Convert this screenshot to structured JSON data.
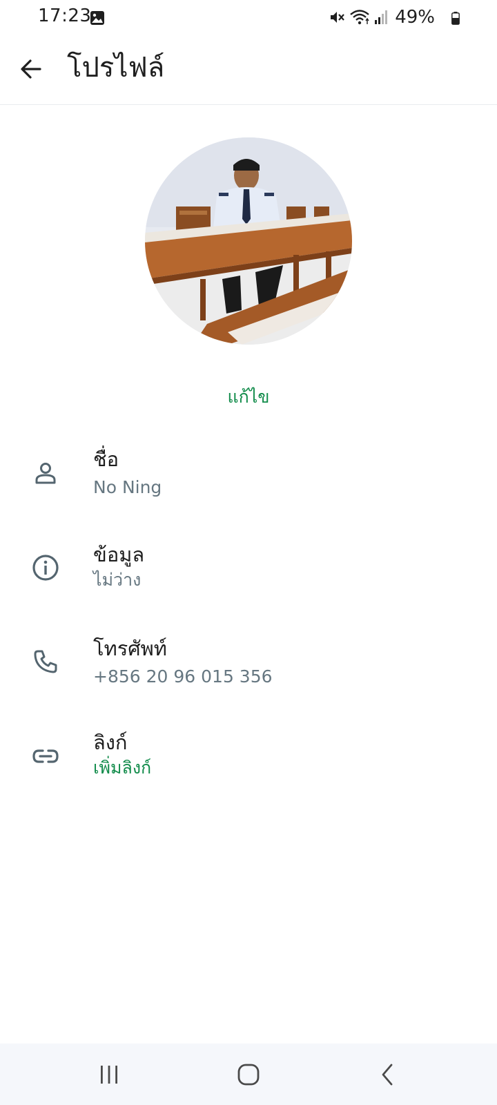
{
  "status_bar": {
    "time": "17:23",
    "battery": "49%",
    "icons": [
      "gallery-icon",
      "mute-icon",
      "wifi-icon",
      "signal-icon",
      "battery-icon"
    ]
  },
  "header": {
    "title": "โปรไฟล์",
    "back_icon": "arrow-left-icon"
  },
  "profile": {
    "edit_label": "แก้ไข"
  },
  "rows": [
    {
      "icon": "person-icon",
      "label": "ชื่อ",
      "value": "No Ning"
    },
    {
      "icon": "info-icon",
      "label": "ข้อมูล",
      "value": "ไม่ว่าง"
    },
    {
      "icon": "phone-icon",
      "label": "โทรศัพท์",
      "value": "+856 20 96 015 356"
    },
    {
      "icon": "link-icon",
      "label": "ลิงก์",
      "value": "เพิ่มลิงก์"
    }
  ],
  "nav": {
    "icons": [
      "recent-apps-icon",
      "home-icon",
      "back-icon"
    ]
  },
  "colors": {
    "accent": "#128c4b",
    "secondary_text": "#667781",
    "icon_gray": "#54656f",
    "nav_background": "#f5f7fb"
  }
}
